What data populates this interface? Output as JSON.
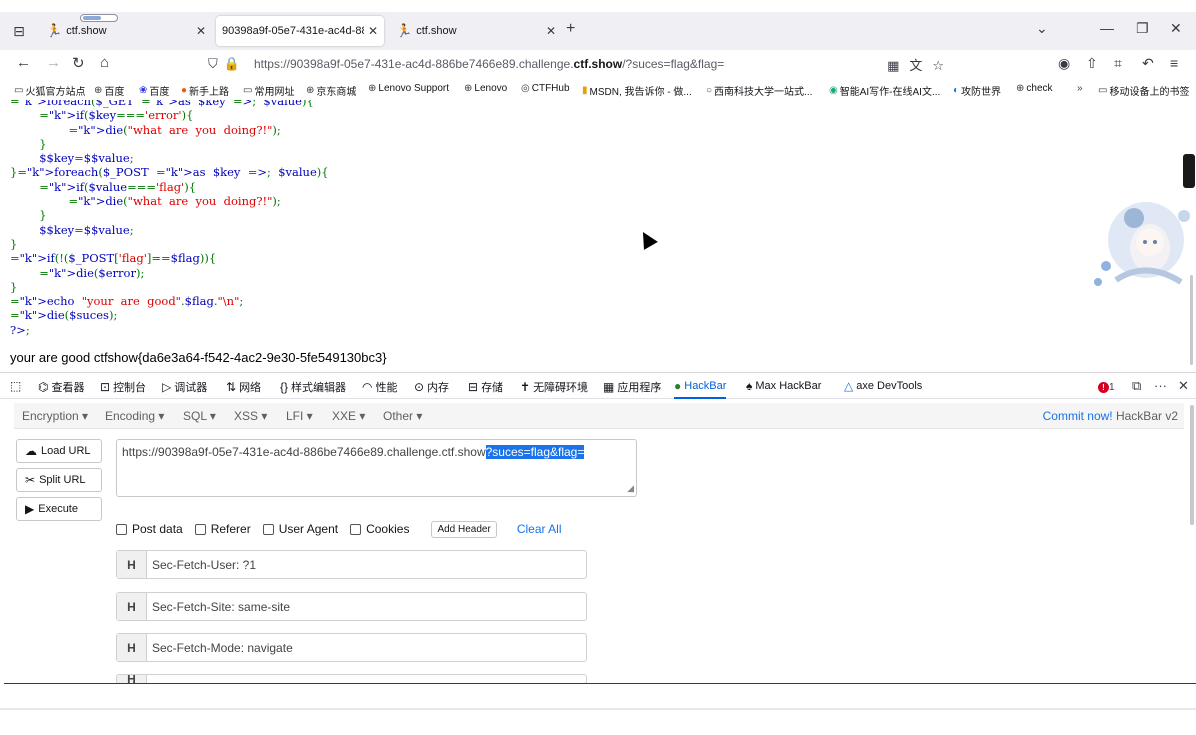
{
  "tabs": [
    {
      "title": "ctf.show",
      "favicon": "ctfshow-icon",
      "active": false
    },
    {
      "title": "90398a9f-05e7-431e-ac4d-886b",
      "favicon": "",
      "active": true
    },
    {
      "title": "ctf.show",
      "favicon": "ctfshow-icon",
      "active": false
    }
  ],
  "nav": {
    "url_prefix": "https://90398a9f-05e7-431e-ac4d-886be7466e89.challenge.",
    "url_domain": "ctf.show",
    "url_suffix": "/?suces=flag&flag="
  },
  "bookmarks": [
    "火狐官方站点",
    "百度",
    "百度",
    "新手上路",
    "常用网址",
    "京东商城",
    "Lenovo Support",
    "Lenovo",
    "CTFHub",
    "MSDN, 我告诉你 - 做...",
    "西南科技大学一站式...",
    "智能AI写作-在线AI文...",
    "攻防世界",
    "check",
    "移动设备上的书签"
  ],
  "code_lines": [
    "foreach($_GET  as  $key  =>  $value){",
    "        if($key==='error'){",
    "                die(\"what  are  you  doing?!\");",
    "        }",
    "        $$key=$$value;",
    "}foreach($_POST  as  $key  =>  $value){",
    "        if($value==='flag'){",
    "                die(\"what  are  you  doing?!\");",
    "        }",
    "        $$key=$$value;",
    "}",
    "if(!($_POST['flag']==$flag)){",
    "        die($error);",
    "}",
    "echo  \"your  are  good\".$flag.\"\\n\";",
    "die($suces);",
    "",
    "?>"
  ],
  "result_text": "your are good ctfshow{da6e3a64-f542-4ac2-9e30-5fe549130bc3}",
  "devtools_tabs": [
    "查看器",
    "控制台",
    "调试器",
    "网络",
    "样式编辑器",
    "性能",
    "内存",
    "存储",
    "无障碍环境",
    "应用程序",
    "HackBar",
    "Max HackBar",
    "axe DevTools"
  ],
  "error_count": "1",
  "hackbar": {
    "menu": [
      "Encryption ▾",
      "Encoding ▾",
      "SQL ▾",
      "XSS ▾",
      "LFI ▾",
      "XXE ▾",
      "Other ▾"
    ],
    "commit_now": "Commit now!",
    "version": "HackBar v2",
    "load_url": "Load URL",
    "split_url": "Split URL",
    "execute": "Execute",
    "url_plain": "https://90398a9f-05e7-431e-ac4d-886be7466e89.challenge.ctf.show",
    "url_selected": "?suces=flag&flag=",
    "checks": [
      "Post data",
      "Referer",
      "User Agent",
      "Cookies"
    ],
    "add_header": "Add Header",
    "clear_all": "Clear All",
    "headers": [
      {
        "tag": "H",
        "value": "Sec-Fetch-User: ?1"
      },
      {
        "tag": "H",
        "value": "Sec-Fetch-Site: same-site"
      },
      {
        "tag": "H",
        "value": "Sec-Fetch-Mode: navigate"
      },
      {
        "tag": "H",
        "value": ""
      }
    ]
  },
  "colors": {
    "accent": "#0061e0",
    "hackbar_link": "#1a73e8",
    "php_keyword": "#007700",
    "php_string": "#dd0000",
    "php_default": "#0000bb"
  }
}
